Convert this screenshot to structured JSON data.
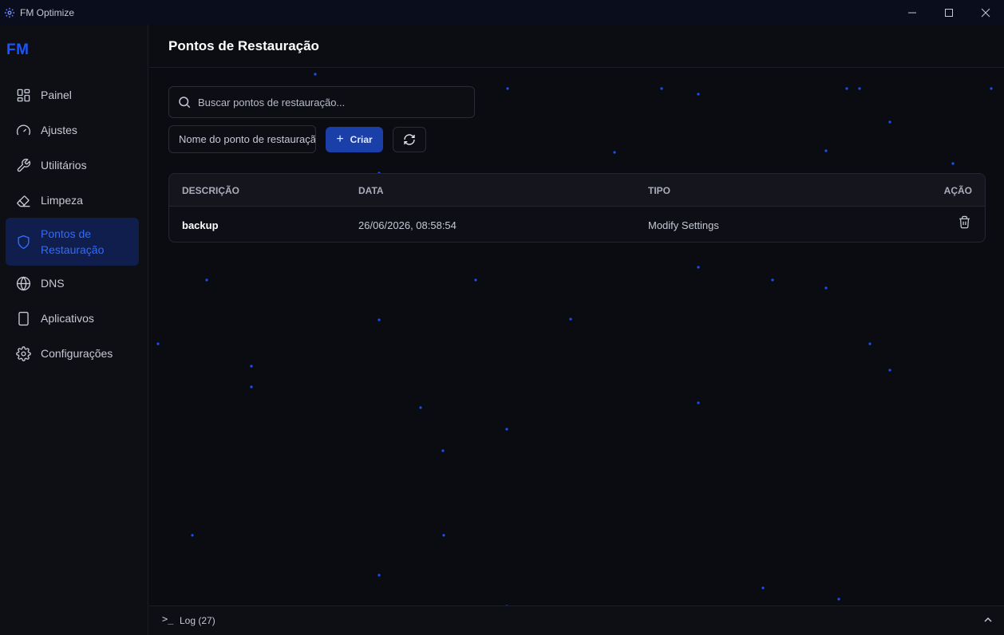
{
  "window": {
    "title": "FM Optimize"
  },
  "sidebar": {
    "logo": "FM",
    "items": [
      {
        "label": "Painel",
        "icon": "dashboard-icon"
      },
      {
        "label": "Ajustes",
        "icon": "gauge-icon"
      },
      {
        "label": "Utilitários",
        "icon": "wrench-icon"
      },
      {
        "label": "Limpeza",
        "icon": "eraser-icon"
      },
      {
        "label": "Pontos de Restauração",
        "icon": "shield-icon",
        "active": true
      },
      {
        "label": "DNS",
        "icon": "globe-icon"
      },
      {
        "label": "Aplicativos",
        "icon": "smartphone-icon"
      },
      {
        "label": "Configurações",
        "icon": "gear-icon"
      }
    ]
  },
  "page": {
    "title": "Pontos de Restauração"
  },
  "search": {
    "placeholder": "Buscar pontos de restauração...",
    "value": ""
  },
  "create_form": {
    "name_placeholder": "Nome do ponto de restauração",
    "create_label": "Criar"
  },
  "table": {
    "headers": {
      "description": "DESCRIÇÃO",
      "date": "DATA",
      "type": "TIPO",
      "action": "AÇÃO"
    },
    "rows": [
      {
        "description": "backup",
        "date": "26/06/2026, 08:58:54",
        "type": "Modify Settings"
      }
    ]
  },
  "log": {
    "label": "Log (27)"
  },
  "colors": {
    "accent": "#1a56ff",
    "active_bg": "#0f1e4d",
    "button_bg": "#1a3fa8",
    "background": "#0b0c12"
  }
}
